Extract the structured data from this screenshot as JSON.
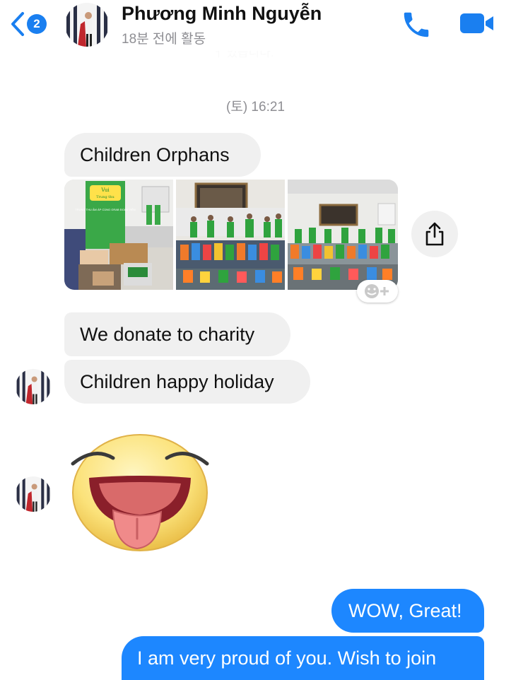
{
  "header": {
    "back_badge": "2",
    "contact_name": "Phương Minh Nguyễn",
    "status": "18분 전에 활동",
    "icons": {
      "back": "chevron-left-icon",
      "call": "phone-icon",
      "video": "video-camera-icon"
    }
  },
  "cutoff_text": "ㅓ 있습니다.",
  "timestamp": "(토) 16:21",
  "messages": {
    "m1": "Children Orphans",
    "m2": "We donate to charity",
    "m3": "Children happy holiday",
    "out1": "WOW, Great!",
    "out2": "I am very proud of you. Wish to join"
  },
  "photos": {
    "banner_line1": "Vui",
    "banner_line2": "Trung thu",
    "banner_text": "TRUNG THU ẤM ÁP CÙNG GRAB ĐOÀN VIÊN"
  },
  "icons": {
    "share": "share-icon",
    "reaction": "add-reaction-icon",
    "sticker": "tongue-out-sticker"
  },
  "colors": {
    "accent": "#1d87ff",
    "incoming_bubble": "#f0f0f0",
    "badge": "#1a7ff0"
  }
}
